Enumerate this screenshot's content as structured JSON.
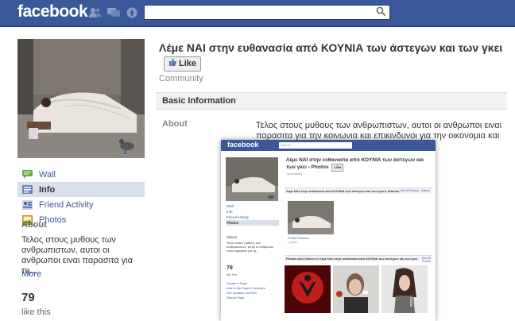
{
  "app": {
    "logo": "facebook",
    "search": {
      "placeholder": "",
      "value": ""
    }
  },
  "page": {
    "title": "Λέμε ΝΑΙ στην ευθανασία από ΚΟΥΝΙΑ των άστεγων και των γκει",
    "like_button": "Like",
    "category": "Community"
  },
  "sidebar": {
    "items": [
      {
        "label": "Wall",
        "icon": "wall-icon",
        "selected": false
      },
      {
        "label": "Info",
        "icon": "info-icon",
        "selected": true
      },
      {
        "label": "Friend Activity",
        "icon": "friend-activity-icon",
        "selected": false
      },
      {
        "label": "Photos",
        "icon": "photos-icon",
        "selected": false
      }
    ],
    "about_heading": "About",
    "about_text": "Τελος στους μυθους των ανθρωπιστων, αυτοι οι ανθρωποι ειναι παρασιτα για τη...",
    "more_link": "More",
    "likes_count": "79",
    "likes_label": "like this"
  },
  "info": {
    "section_heading": "Basic Information",
    "about_label": "About",
    "about_value": "Τελος στους μυθους των ανθρωπιστων, αυτοι οι ανθρωποι ειναι παρασιτα για την κοινωνια και επικινδυνοι για την οικονομια και την υγεια μας"
  },
  "overlay": {
    "logo": "facebook",
    "search_placeholder": "Search",
    "title": "Λέμε ΝΑΙ στην ευθανασία από ΚΟΥΝΙΑ των άστεγων και των γκει › Photos",
    "like_button": "Like",
    "category": "Community",
    "nav": [
      "Wall",
      "Info",
      "Friend Activity",
      "Photos"
    ],
    "about_heading": "About",
    "about_text": "Τελος στους μυθους των ανθρωπιστων, αυτοι οι ανθρωποι ειναι παρασιτα για τη...",
    "likes_count": "79",
    "likes_label": "like this",
    "links": [
      "Create a Page",
      "Add to My Page's Favorites",
      "Get Updates via RSS",
      "Report Page"
    ],
    "album_section": "Λέμε ΝΑΙ στην ευθανασία από ΚΟΥΝΙΑ των άστεγων και των γκει's Albums",
    "album_section_right": "See All Photos · Videos",
    "album_name": "Profile Pictures",
    "album_count": "1 photo",
    "photos_section": "Photos and Videos of Λέμε ΝΑΙ στην ευθανασία από ΚΟΥΝΙΑ των άστεγων και των γκει",
    "photos_section_right": "See All Photos"
  },
  "colors": {
    "brand_blue": "#3b5998",
    "selected_nav": "#d8dfea"
  }
}
